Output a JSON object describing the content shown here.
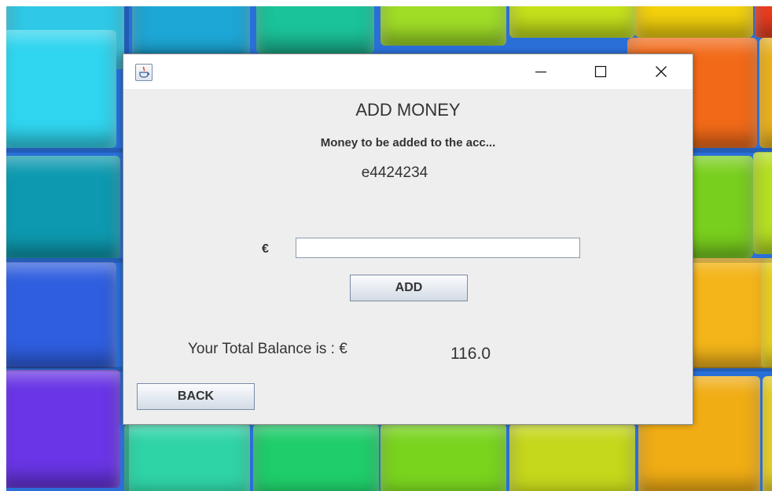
{
  "window": {
    "title": "",
    "controls": {
      "minimize": "minimize-icon",
      "maximize": "maximize-icon",
      "close": "close-icon"
    },
    "app_icon": "java-app-icon"
  },
  "form": {
    "heading": "ADD MONEY",
    "subheading": "Money to be added to the acc...",
    "account_id": "e4424234",
    "currency_symbol": "€",
    "amount_input": {
      "value": "",
      "placeholder": ""
    },
    "add_button_label": "ADD",
    "balance_label": "Your Total Balance is : €",
    "balance_value": "116.0",
    "back_button_label": "BACK"
  },
  "colors": {
    "window_bg": "#eeeeee",
    "titlebar_bg": "#ffffff",
    "text": "#333333"
  }
}
